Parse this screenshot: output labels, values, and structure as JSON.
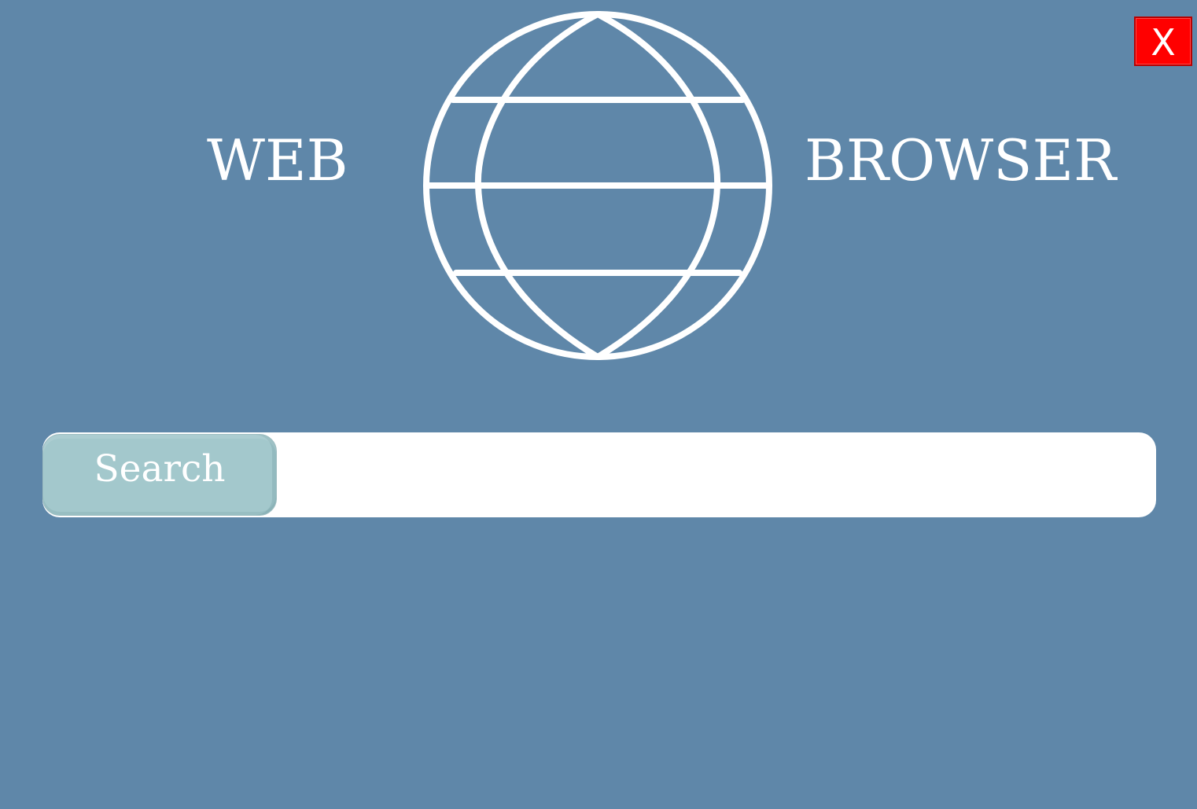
{
  "window": {
    "close_label": "X"
  },
  "brand": {
    "left_text": "WEB",
    "right_text": "BROWSER",
    "icon": "globe-icon"
  },
  "search": {
    "button_label": "Search",
    "input_value": "",
    "placeholder": ""
  },
  "colors": {
    "background": "#5f87a9",
    "foreground": "#ffffff",
    "search_button": "#a3c8cc",
    "close_button": "#ff0000"
  },
  "icons": {
    "close": "close-icon",
    "globe": "globe-icon"
  }
}
